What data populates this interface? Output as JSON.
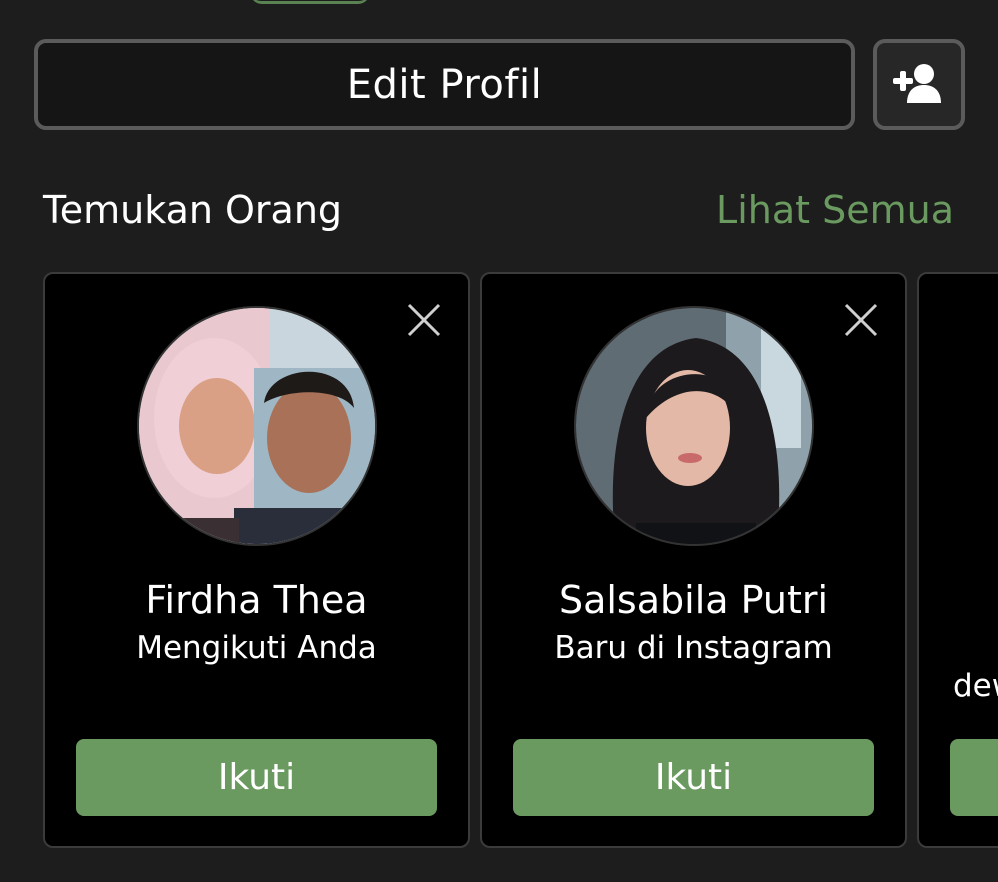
{
  "profile": {
    "edit_label": "Edit Profil",
    "add_icon": "add-person-icon"
  },
  "suggestions": {
    "title": "Temukan Orang",
    "see_all": "Lihat Semua",
    "cards": [
      {
        "name": "Firdha Thea",
        "status": "Mengikuti Anda",
        "follow_label": "Ikuti"
      },
      {
        "name": "Salsabila Putri",
        "status": "Baru di Instagram",
        "follow_label": "Ikuti"
      },
      {
        "name": "",
        "status": "dew",
        "follow_label": ""
      }
    ]
  },
  "colors": {
    "accent_green": "#6a9a5f",
    "background": "#1c1d1c",
    "card": "#000000"
  }
}
